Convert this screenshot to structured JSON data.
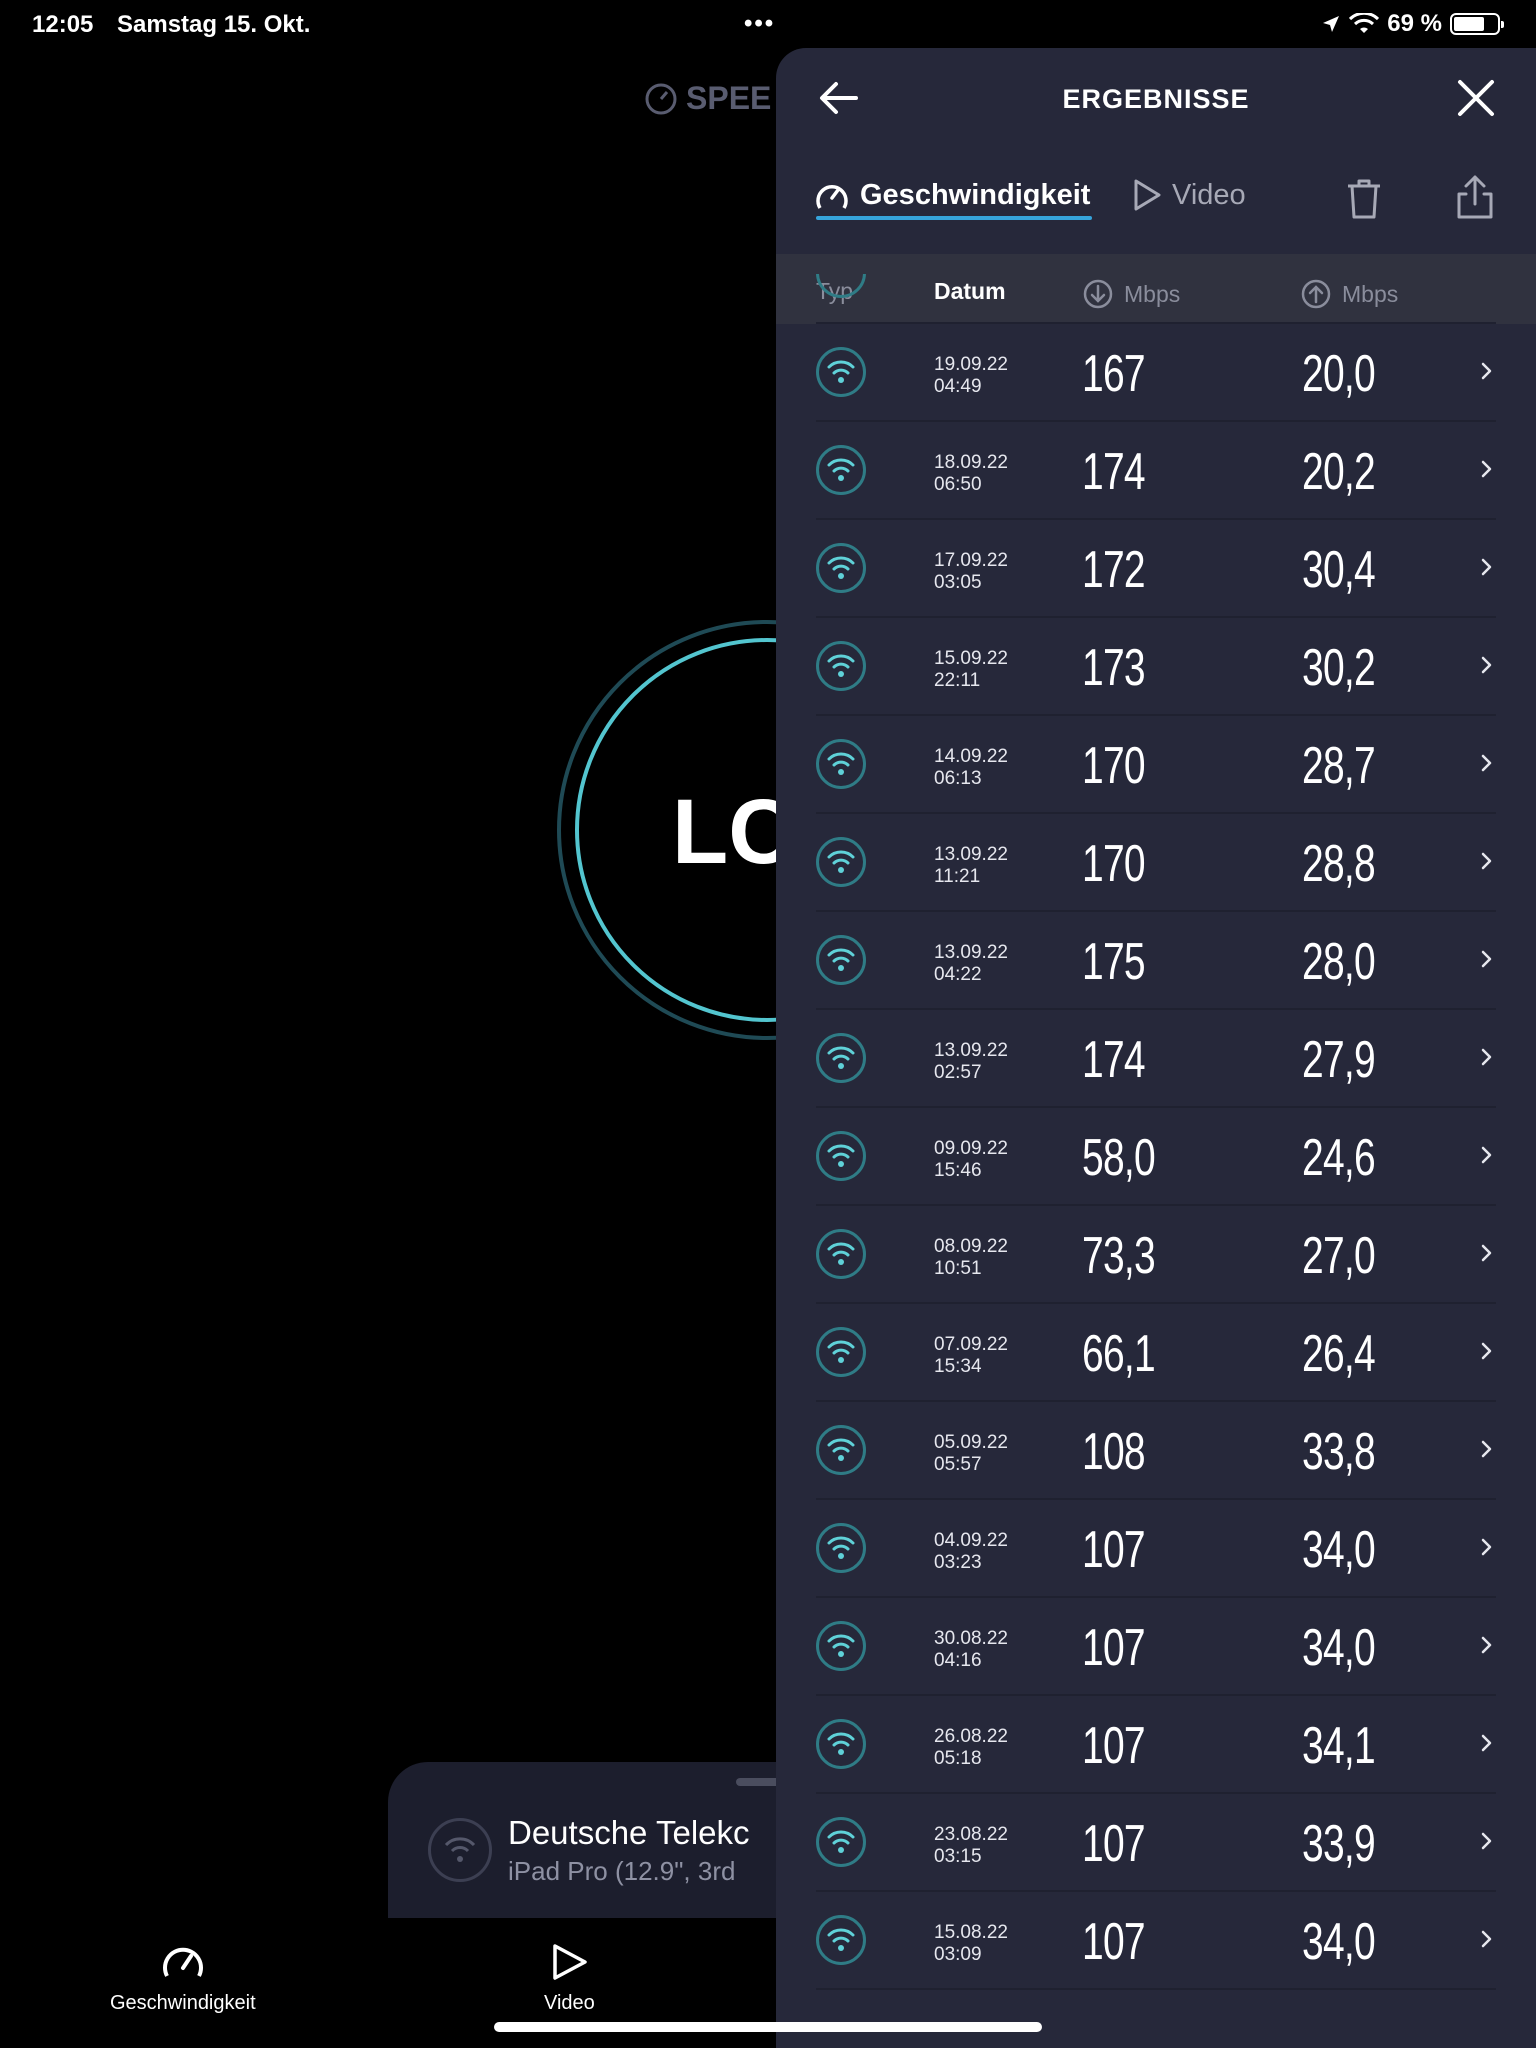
{
  "status_bar": {
    "time": "12:05",
    "date": "Samstag 15. Okt.",
    "battery": "69 %"
  },
  "background": {
    "speed_label": "SPEE",
    "ring_text": "LC",
    "provider_name": "Deutsche Telekc",
    "provider_device": "iPad Pro (12.9\", 3rd",
    "tabs": [
      "Geschwindigkeit",
      "Video"
    ]
  },
  "panel": {
    "title": "ERGEBNISSE",
    "tabs": [
      {
        "label": "Geschwindigkeit",
        "active": true
      },
      {
        "label": "Video",
        "active": false
      }
    ],
    "columns": {
      "typ": "Typ",
      "datum": "Datum",
      "download": "Mbps",
      "upload": "Mbps"
    },
    "rows": [
      {
        "date": "19.09.22",
        "time": "04:49",
        "down": "167",
        "up": "20,0"
      },
      {
        "date": "18.09.22",
        "time": "06:50",
        "down": "174",
        "up": "20,2"
      },
      {
        "date": "17.09.22",
        "time": "03:05",
        "down": "172",
        "up": "30,4"
      },
      {
        "date": "15.09.22",
        "time": "22:11",
        "down": "173",
        "up": "30,2"
      },
      {
        "date": "14.09.22",
        "time": "06:13",
        "down": "170",
        "up": "28,7"
      },
      {
        "date": "13.09.22",
        "time": "11:21",
        "down": "170",
        "up": "28,8"
      },
      {
        "date": "13.09.22",
        "time": "04:22",
        "down": "175",
        "up": "28,0"
      },
      {
        "date": "13.09.22",
        "time": "02:57",
        "down": "174",
        "up": "27,9"
      },
      {
        "date": "09.09.22",
        "time": "15:46",
        "down": "58,0",
        "up": "24,6"
      },
      {
        "date": "08.09.22",
        "time": "10:51",
        "down": "73,3",
        "up": "27,0"
      },
      {
        "date": "07.09.22",
        "time": "15:34",
        "down": "66,1",
        "up": "26,4"
      },
      {
        "date": "05.09.22",
        "time": "05:57",
        "down": "108",
        "up": "33,8"
      },
      {
        "date": "04.09.22",
        "time": "03:23",
        "down": "107",
        "up": "34,0"
      },
      {
        "date": "30.08.22",
        "time": "04:16",
        "down": "107",
        "up": "34,0"
      },
      {
        "date": "26.08.22",
        "time": "05:18",
        "down": "107",
        "up": "34,1"
      },
      {
        "date": "23.08.22",
        "time": "03:15",
        "down": "107",
        "up": "33,9"
      },
      {
        "date": "15.08.22",
        "time": "03:09",
        "down": "107",
        "up": "34,0"
      }
    ]
  },
  "colors": {
    "panel_bg": "#26283a",
    "accent": "#36a4db",
    "wifi_teal": "#5fd1d8"
  }
}
